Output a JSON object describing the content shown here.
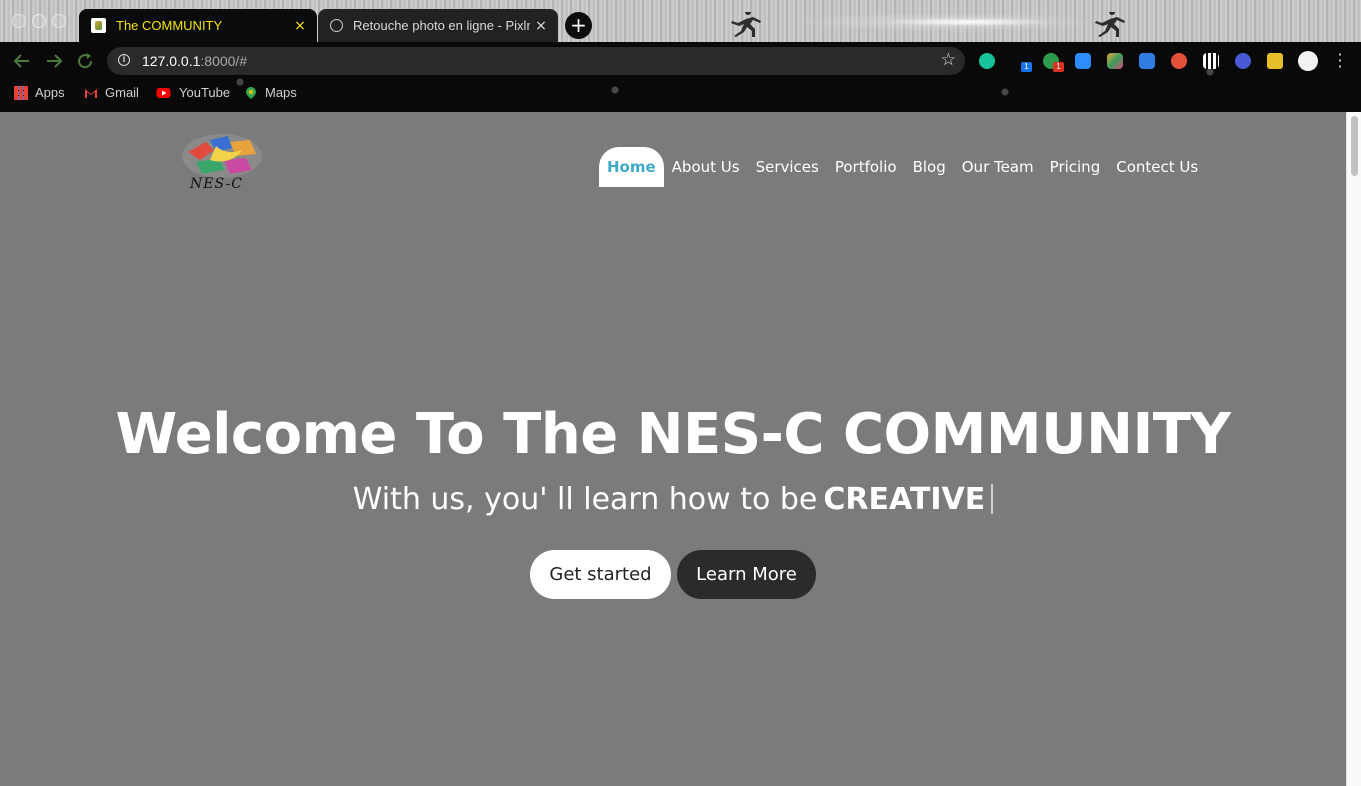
{
  "browser": {
    "tabs": [
      {
        "title": "The COMMUNITY",
        "active": true
      },
      {
        "title": "Retouche photo en ligne - Pixlr",
        "active": false
      }
    ],
    "close_glyph": "×",
    "new_tab_glyph": "+",
    "address": {
      "host": "127.0.0.1",
      "rest": ":8000/#"
    },
    "nav_icons": [
      "back-arrow-icon",
      "forward-arrow-icon",
      "reload-icon"
    ],
    "star_glyph": "☆",
    "extensions": [
      {
        "name": "grammarly-icon",
        "color": "#15c39a"
      },
      {
        "name": "extension-badge-blue-icon",
        "color": "#1a73e8",
        "badge": "1"
      },
      {
        "name": "extension-green-icon",
        "color": "#2e9a4b",
        "badge": "1"
      },
      {
        "name": "zoom-icon",
        "color": "#2d8cff"
      },
      {
        "name": "colorful-extension-icon",
        "color": "#e8a33c"
      },
      {
        "name": "download-icon",
        "color": "#2f7de1"
      },
      {
        "name": "red-extension-icon",
        "color": "#e4513a"
      },
      {
        "name": "qr-code-icon",
        "color": "#ffffff"
      },
      {
        "name": "blocker-icon",
        "color": "#4a5ad6"
      },
      {
        "name": "puzzle-extensions-icon",
        "color": "#e5c02a"
      },
      {
        "name": "profile-avatar-icon",
        "color": "#f2f2f2"
      }
    ],
    "bookmarks": [
      {
        "label": "Apps",
        "icon": "apps-grid-icon"
      },
      {
        "label": "Gmail",
        "icon": "gmail-icon"
      },
      {
        "label": "YouTube",
        "icon": "youtube-icon"
      },
      {
        "label": "Maps",
        "icon": "maps-pin-icon"
      }
    ]
  },
  "site": {
    "logo_text": "NES-C",
    "nav": [
      {
        "label": "Home",
        "active": true
      },
      {
        "label": "About Us"
      },
      {
        "label": "Services"
      },
      {
        "label": "Portfolio"
      },
      {
        "label": "Blog"
      },
      {
        "label": "Our Team"
      },
      {
        "label": "Pricing"
      },
      {
        "label": "Contect Us"
      }
    ],
    "accent_color": "#3fa9c9",
    "hero": {
      "title": "Welcome To The NES-C COMMUNITY",
      "subtitle_prefix": "With us, you' ll learn how to be",
      "subtitle_highlight": "CREATIVE",
      "buttons": {
        "primary": "Get started",
        "secondary": "Learn More"
      }
    }
  }
}
